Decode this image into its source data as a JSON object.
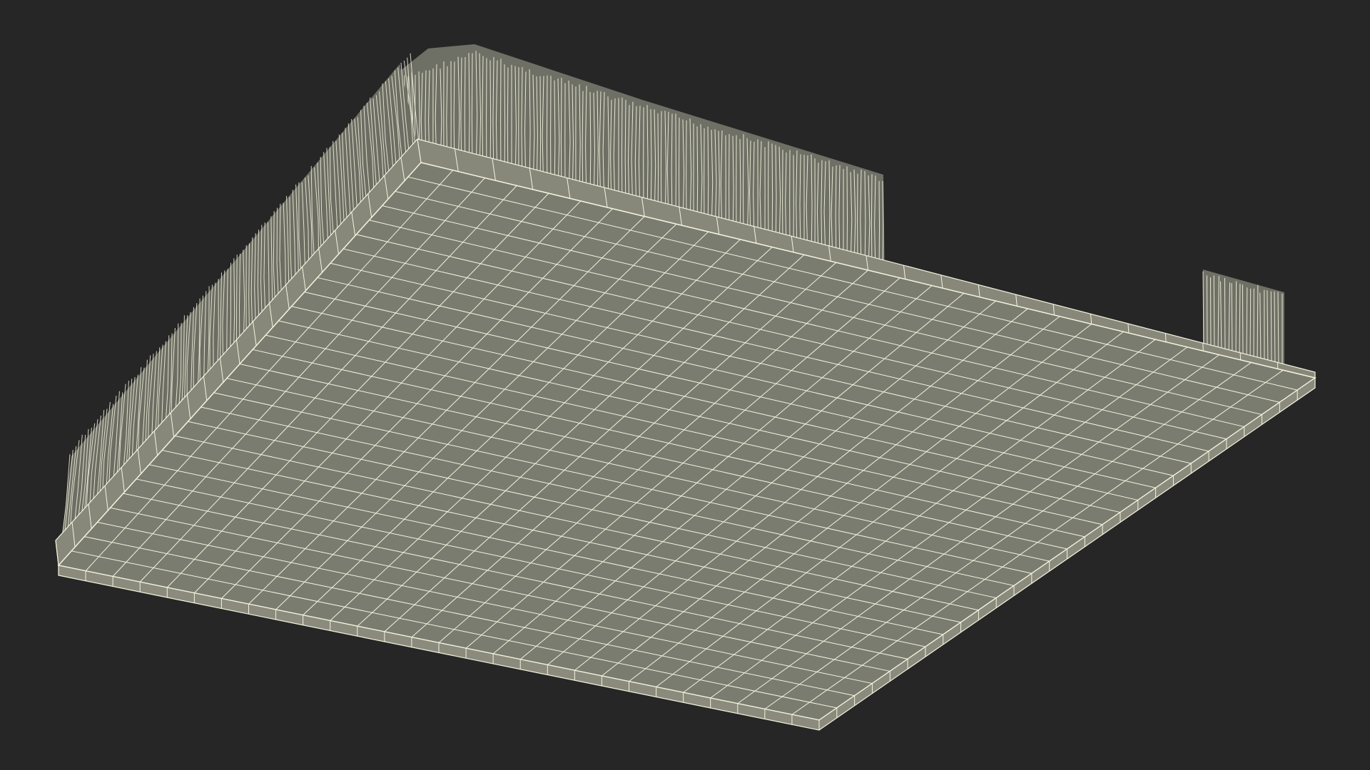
{
  "scene": {
    "background_color": "#262626",
    "model": {
      "name": "wireframe-panel-model",
      "render_mode": "wireframe",
      "surface_color": "#7a7c6f",
      "wire_color": "#f3f3de",
      "plate_grid": {
        "columns": 28,
        "rows": 28
      }
    }
  }
}
